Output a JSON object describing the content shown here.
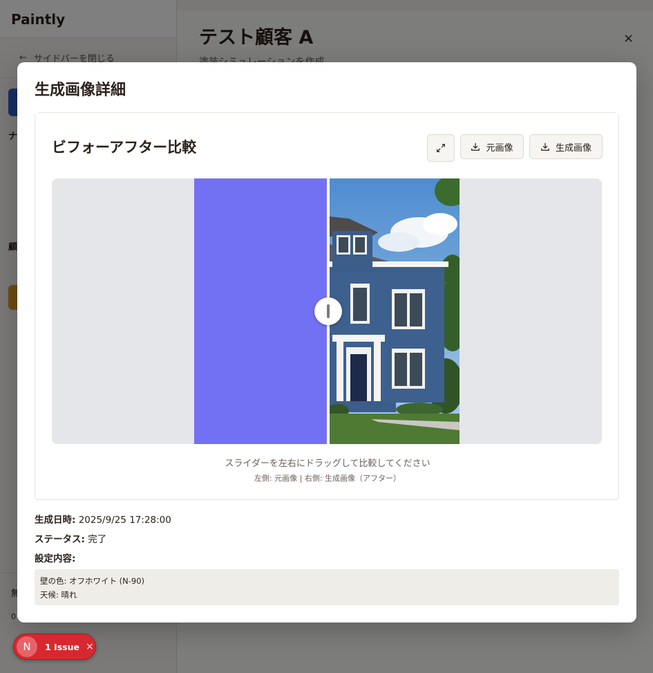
{
  "app": {
    "brand": "Paintly",
    "close_sidebar": "サイドバーを閉じる"
  },
  "sidebar_fragments": {
    "a": "ナ",
    "b": "顧",
    "c": "無",
    "d": "0"
  },
  "page": {
    "title": "テスト顧客 A",
    "subtitle": "塗装シミュレーションを作成",
    "close": "×"
  },
  "modal": {
    "title": "生成画像詳細",
    "card_title": "ビフォーアフター比較",
    "buttons": {
      "original": "元画像",
      "generated": "生成画像"
    },
    "hint_main": "スライダーを左右にドラッグして比較してください",
    "hint_sub": "左側: 元画像 | 右側: 生成画像（アフター）",
    "meta": {
      "date_label": "生成日時:",
      "date_value": "2025/9/25 17:28:00",
      "status_label": "ステータス:",
      "status_value": "完了",
      "settings_label": "設定内容:"
    },
    "settings": [
      "壁の色: オフホワイト (N-90)",
      "天候: 晴れ"
    ]
  },
  "issue_badge": {
    "avatar": "N",
    "label": "1 Issue",
    "close": "×"
  },
  "colors": {
    "before_placeholder": "#7371f3",
    "house_blue": "#3b5d8a",
    "issue_red": "#d7282f"
  }
}
